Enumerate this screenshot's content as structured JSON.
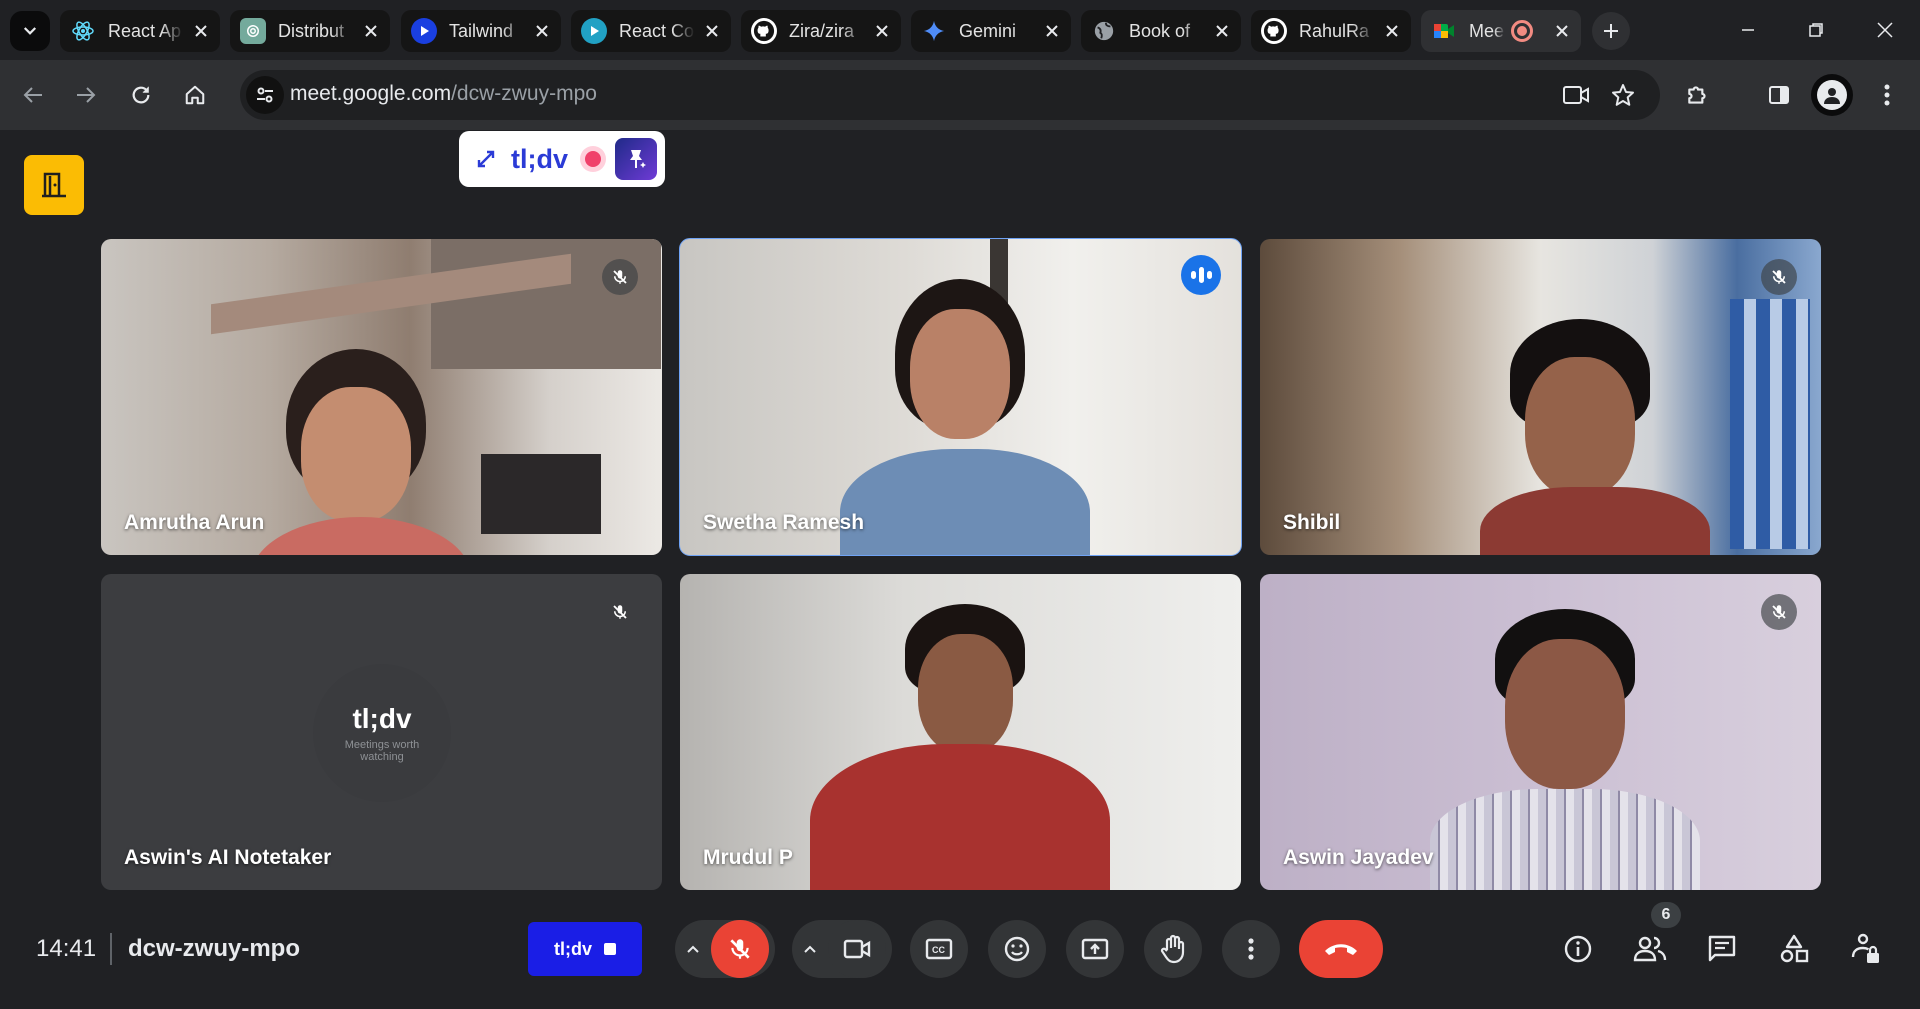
{
  "browser": {
    "tabs": [
      {
        "title": "React Ap",
        "favicon": "react-icon",
        "color": "#61dafb"
      },
      {
        "title": "Distribut",
        "favicon": "chatgpt-icon",
        "color": "#74aa9c"
      },
      {
        "title": "Tailwind",
        "favicon": "play-icon",
        "color": "#1a73e8"
      },
      {
        "title": "React Co",
        "favicon": "play-icon",
        "color": "#21a1c4"
      },
      {
        "title": "Zira/zira",
        "favicon": "github-icon",
        "color": "#ffffff"
      },
      {
        "title": "Gemini",
        "favicon": "gemini-icon",
        "color": "#4285f4"
      },
      {
        "title": "Book of",
        "favicon": "globe-icon",
        "color": "#9aa0a6"
      },
      {
        "title": "RahulRa",
        "favicon": "github-icon",
        "color": "#ffffff"
      },
      {
        "title": "Mee",
        "favicon": "google-meet-icon",
        "color": "#00ac47"
      }
    ],
    "url_host": "meet.google.com",
    "url_path": "/dcw-zwuy-mpo"
  },
  "tldv_widget": {
    "brand": "tl;dv"
  },
  "participants": [
    {
      "name": "Amrutha Arun",
      "muted": true,
      "speaking": false
    },
    {
      "name": "Swetha Ramesh",
      "muted": false,
      "speaking": true
    },
    {
      "name": "Shibil",
      "muted": true,
      "speaking": false
    },
    {
      "name": "Aswin's AI Notetaker",
      "muted": true,
      "speaking": false,
      "avatar_logo": "tl;dv",
      "avatar_tagline": "Meetings worth watching"
    },
    {
      "name": "Mrudul P",
      "muted": false,
      "speaking": false
    },
    {
      "name": "Aswin Jayadev",
      "muted": true,
      "speaking": false
    }
  ],
  "controls": {
    "time": "14:41",
    "meeting_code": "dcw-zwuy-mpo",
    "tldv_button_label": "tl;dv",
    "people_count": "6",
    "mic_state": "muted",
    "accent_red": "#ea4335",
    "accent_blue": "#1a73e8"
  }
}
